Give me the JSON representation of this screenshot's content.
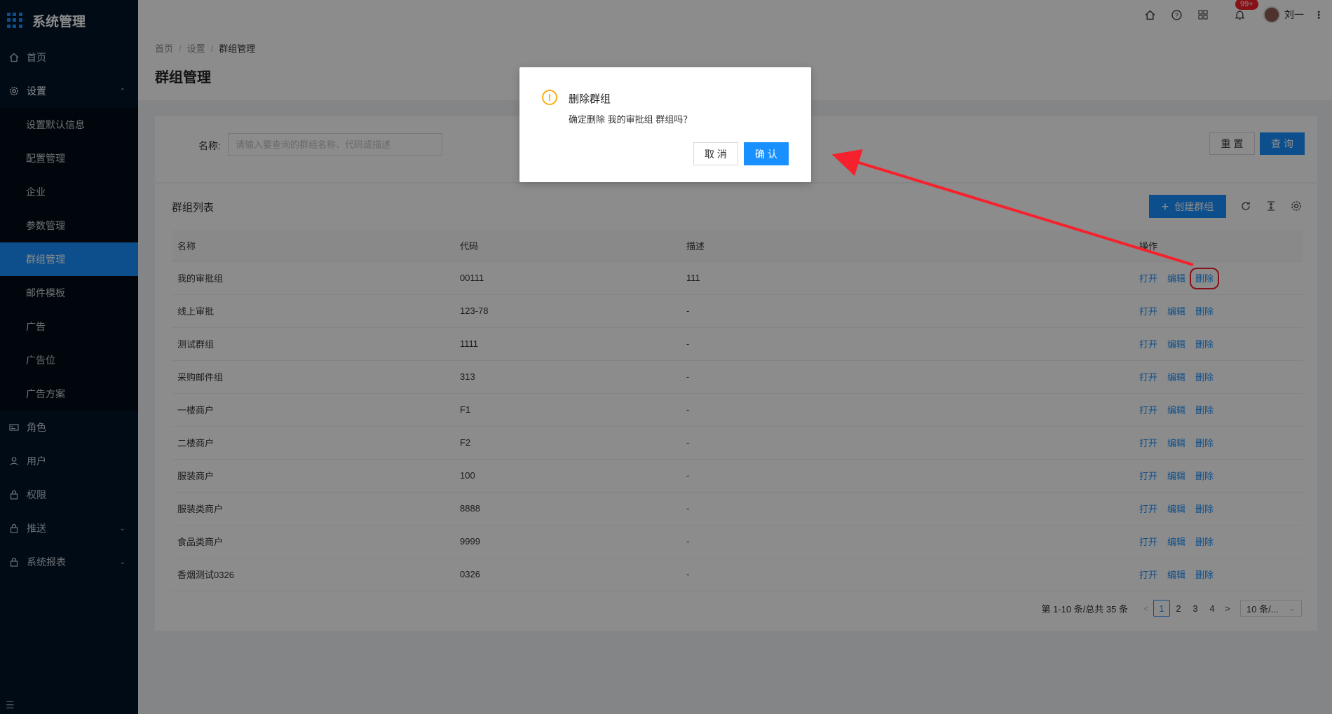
{
  "app": {
    "title": "系统管理"
  },
  "sidebar": {
    "items": [
      {
        "label": "首页",
        "icon": "home-icon"
      },
      {
        "label": "设置",
        "icon": "gear-icon",
        "open": true
      },
      {
        "label": "角色",
        "icon": "id-card-icon"
      },
      {
        "label": "用户",
        "icon": "user-icon"
      },
      {
        "label": "权限",
        "icon": "lock-icon"
      },
      {
        "label": "推送",
        "icon": "lock-icon"
      },
      {
        "label": "系统报表",
        "icon": "lock-icon"
      }
    ],
    "submenu": [
      {
        "label": "设置默认信息"
      },
      {
        "label": "配置管理"
      },
      {
        "label": "企业"
      },
      {
        "label": "参数管理"
      },
      {
        "label": "群组管理",
        "active": true
      },
      {
        "label": "邮件模板"
      },
      {
        "label": "广告"
      },
      {
        "label": "广告位"
      },
      {
        "label": "广告方案"
      }
    ]
  },
  "header": {
    "badge": "99+",
    "username": "刘一"
  },
  "breadcrumb": {
    "home": "首页",
    "settings": "设置",
    "current": "群组管理"
  },
  "page": {
    "title": "群组管理"
  },
  "search": {
    "label": "名称:",
    "placeholder": "请输入要查询的群组名称、代码或描述",
    "reset": "重 置",
    "query": "查 询"
  },
  "table": {
    "title": "群组列表",
    "create": "创建群组",
    "columns": {
      "name": "名称",
      "code": "代码",
      "desc": "描述",
      "ops": "操作"
    },
    "ops": {
      "open": "打开",
      "edit": "编辑",
      "delete": "删除"
    },
    "rows": [
      {
        "name": "我的审批组",
        "code": "00111",
        "desc": "111"
      },
      {
        "name": "线上审批",
        "code": "123-78",
        "desc": "-"
      },
      {
        "name": "测试群组",
        "code": "1111",
        "desc": "-"
      },
      {
        "name": "采购邮件组",
        "code": "313",
        "desc": "-"
      },
      {
        "name": "一楼商户",
        "code": "F1",
        "desc": "-"
      },
      {
        "name": "二楼商户",
        "code": "F2",
        "desc": "-"
      },
      {
        "name": "服装商户",
        "code": "100",
        "desc": "-"
      },
      {
        "name": "服装类商户",
        "code": "8888",
        "desc": "-"
      },
      {
        "name": "食品类商户",
        "code": "9999",
        "desc": "-"
      },
      {
        "name": "香烟测试0326",
        "code": "0326",
        "desc": "-"
      }
    ]
  },
  "pagination": {
    "total": "第 1-10 条/总共 35 条",
    "pages": [
      "1",
      "2",
      "3",
      "4"
    ],
    "current": "1",
    "size": "10 条/..."
  },
  "modal": {
    "title": "删除群组",
    "content": "确定删除 我的审批组 群组吗？",
    "cancel": "取 消",
    "ok": "确 认"
  },
  "colors": {
    "primary": "#1890ff",
    "sidebar": "#001529",
    "warning": "#faad14",
    "annotation": "#f5222d"
  }
}
